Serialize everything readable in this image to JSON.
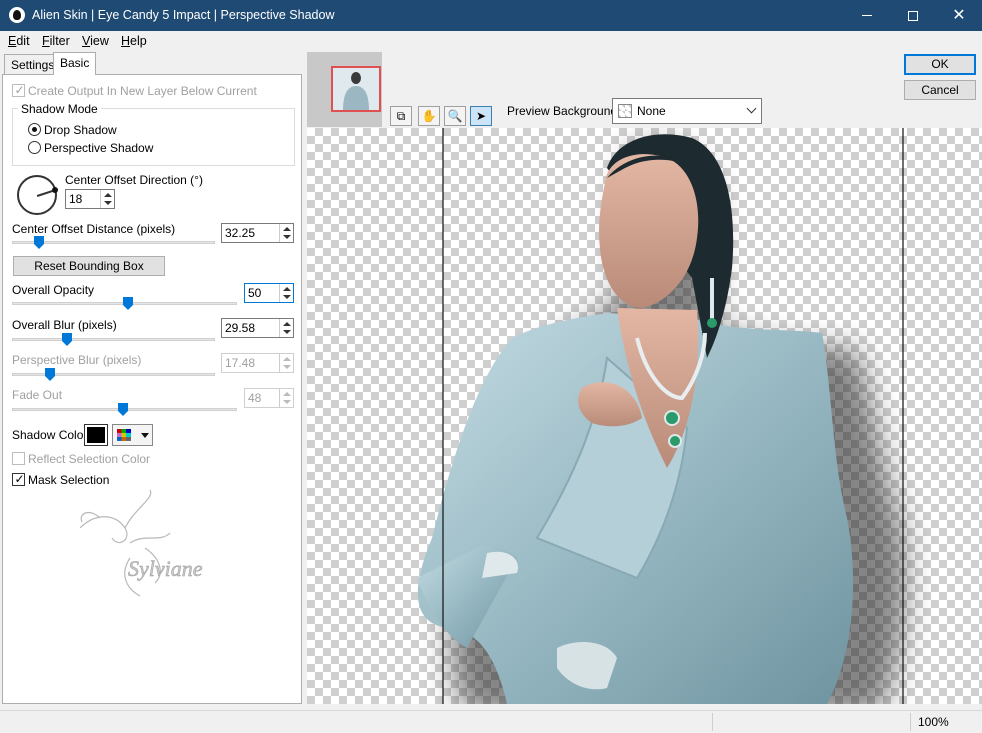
{
  "window": {
    "title": "Alien Skin | Eye Candy 5 Impact | Perspective Shadow"
  },
  "menu": [
    {
      "key": "E",
      "rest": "dit"
    },
    {
      "key": "F",
      "rest": "ilter"
    },
    {
      "key": "V",
      "rest": "iew"
    },
    {
      "key": "H",
      "rest": "elp"
    }
  ],
  "tabs": {
    "settings": "Settings",
    "basic": "Basic"
  },
  "basic": {
    "create_output": "Create Output In New Layer Below Current",
    "shadow_mode": {
      "label": "Shadow Mode",
      "drop": "Drop Shadow",
      "perspective": "Perspective Shadow",
      "selected": "Drop Shadow"
    },
    "center_offset_direction": {
      "label": "Center Offset Direction (°)",
      "value": "18"
    },
    "center_offset_distance": {
      "label": "Center Offset Distance (pixels)",
      "value": "32.25"
    },
    "reset_bounding_box": "Reset Bounding Box",
    "overall_opacity": {
      "label": "Overall Opacity",
      "value": "50"
    },
    "overall_blur": {
      "label": "Overall Blur (pixels)",
      "value": "29.58"
    },
    "perspective_blur": {
      "label": "Perspective Blur (pixels)",
      "value": "17.48"
    },
    "fade_out": {
      "label": "Fade Out",
      "value": "48"
    },
    "shadow_color": {
      "label": "Shadow Color",
      "color": "#000000"
    },
    "reflect_selection_color": "Reflect Selection Color",
    "mask_selection": "Mask Selection",
    "watermark": "Sylviane"
  },
  "preview": {
    "background_label": "Preview Background:",
    "background_value": "None",
    "tools": [
      "compare-icon",
      "hand-icon",
      "zoom-icon",
      "arrow-icon"
    ]
  },
  "buttons": {
    "ok": "OK",
    "cancel": "Cancel"
  },
  "status": {
    "zoom": "100%"
  }
}
